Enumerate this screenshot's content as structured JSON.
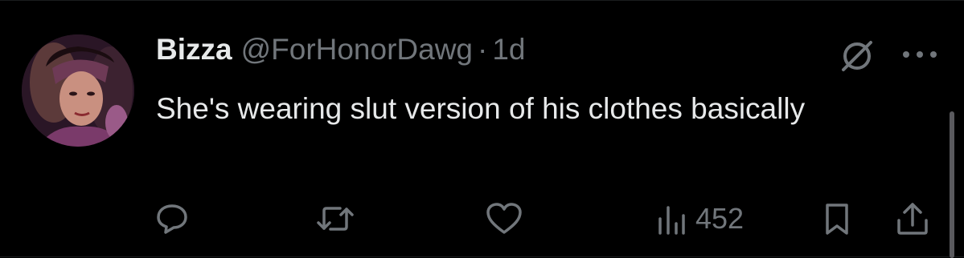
{
  "tweet": {
    "author": {
      "display_name": "Bizza",
      "handle": "@ForHonorDawg",
      "avatar_icon": "avatar-photo"
    },
    "separator": "·",
    "time": "1d",
    "text": "She's wearing slut version of his clothes basically",
    "header_icons": [
      "grok-icon",
      "more-icon"
    ],
    "actions": {
      "reply_icon": "speech-bubble-icon",
      "retweet_icon": "retweet-icon",
      "like_icon": "heart-icon",
      "views_icon": "bar-chart-icon",
      "views_count": "452",
      "bookmark_icon": "bookmark-icon",
      "share_icon": "share-icon"
    }
  },
  "colors": {
    "background": "#000000",
    "primary_text": "#e7e9ea",
    "secondary_text": "#71767b"
  }
}
